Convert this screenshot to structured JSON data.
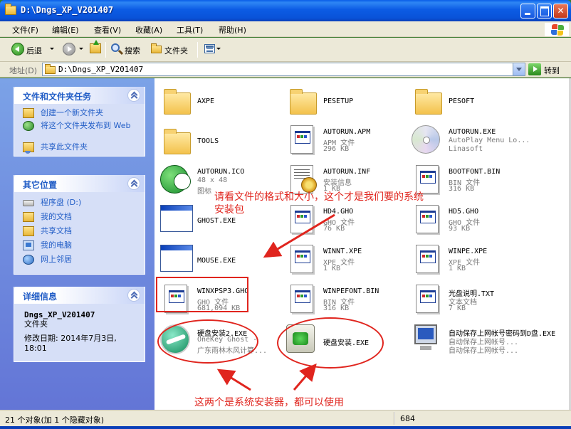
{
  "window": {
    "title": "D:\\Dngs_XP_V201407"
  },
  "menu": {
    "items": [
      "文件(F)",
      "编辑(E)",
      "查看(V)",
      "收藏(A)",
      "工具(T)",
      "帮助(H)"
    ]
  },
  "toolbar": {
    "back_label": "后退",
    "search_label": "搜索",
    "folders_label": "文件夹"
  },
  "address": {
    "label": "地址(D)",
    "value": "D:\\Dngs_XP_V201407",
    "go_label": "转到"
  },
  "tasks_panel": {
    "title": "文件和文件夹任务",
    "items": [
      "创建一个新文件夹",
      "将这个文件夹发布到 Web",
      "共享此文件夹"
    ]
  },
  "places_panel": {
    "title": "其它位置",
    "items": [
      "程序盘 (D:)",
      "我的文档",
      "共享文档",
      "我的电脑",
      "网上邻居"
    ]
  },
  "details_panel": {
    "title": "详细信息",
    "name": "Dngs_XP_V201407",
    "type": "文件夹",
    "modified_label": "修改日期: 2014年7月3日,",
    "modified_time": "18:01"
  },
  "files": [
    {
      "name": "AXPE",
      "l1": "",
      "l2": "",
      "icon": "folder-icon"
    },
    {
      "name": "PESETUP",
      "l1": "",
      "l2": "",
      "icon": "folder-icon"
    },
    {
      "name": "PESOFT",
      "l1": "",
      "l2": "",
      "icon": "folder-icon"
    },
    {
      "name": "TOOLS",
      "l1": "",
      "l2": "",
      "icon": "folder-icon"
    },
    {
      "name": "AUTORUN.APM",
      "l1": "APM 文件",
      "l2": "296 KB",
      "icon": "file-icon"
    },
    {
      "name": "AUTORUN.EXE",
      "l1": "AutoPlay Menu Lo...",
      "l2": "Linasoft",
      "icon": "cd-icon"
    },
    {
      "name": "AUTORUN.ICO",
      "l1": "48 x 48",
      "l2": "图标",
      "icon": "green-disc-icon"
    },
    {
      "name": "AUTORUN.INF",
      "l1": "安装信息",
      "l2": "1 KB",
      "icon": "inf-icon"
    },
    {
      "name": "BOOTFONT.BIN",
      "l1": "BIN 文件",
      "l2": "316 KB",
      "icon": "file-icon"
    },
    {
      "name": "GHOST.EXE",
      "l1": "",
      "l2": "",
      "icon": "app-window-icon"
    },
    {
      "name": "HD4.GHO",
      "l1": "GHO 文件",
      "l2": "76 KB",
      "icon": "file-icon"
    },
    {
      "name": "HD5.GHO",
      "l1": "GHO 文件",
      "l2": "93 KB",
      "icon": "file-icon"
    },
    {
      "name": "MOUSE.EXE",
      "l1": "",
      "l2": "",
      "icon": "app-window-icon"
    },
    {
      "name": "WINNT.XPE",
      "l1": "XPE 文件",
      "l2": "1 KB",
      "icon": "file-icon"
    },
    {
      "name": "WINPE.XPE",
      "l1": "XPE 文件",
      "l2": "1 KB",
      "icon": "file-icon"
    },
    {
      "name": "WINXPSP3.GHO",
      "l1": "GHO 文件",
      "l2": "681,094 KB",
      "icon": "file-icon"
    },
    {
      "name": "WINPEFONT.BIN",
      "l1": "BIN 文件",
      "l2": "316 KB",
      "icon": "file-icon"
    },
    {
      "name": "光盘说明.TXT",
      "l1": "文本文档",
      "l2": "7 KB",
      "icon": "file-icon"
    },
    {
      "name": "硬盘安装2.EXE",
      "l1": "OneKey Ghost -",
      "l2": "广东雨林木风计算...",
      "icon": "ghost-icon"
    },
    {
      "name": "硬盘安装.EXE",
      "l1": "",
      "l2": "",
      "icon": "setup-icon"
    },
    {
      "name": "自动保存上网帐号密码到D盘.EXE",
      "l1": "自动保存上网帐号...",
      "l2": "自动保存上网帐号...",
      "icon": "pc-icon"
    }
  ],
  "annotations": {
    "top_note": "请看文件的格式和大小，这个才是我们要的系统安装包",
    "bottom_note": "这两个是系统安装器，都可以使用"
  },
  "status": {
    "left": "21 个对象(加 1 个隐藏对象)",
    "right": "684"
  }
}
